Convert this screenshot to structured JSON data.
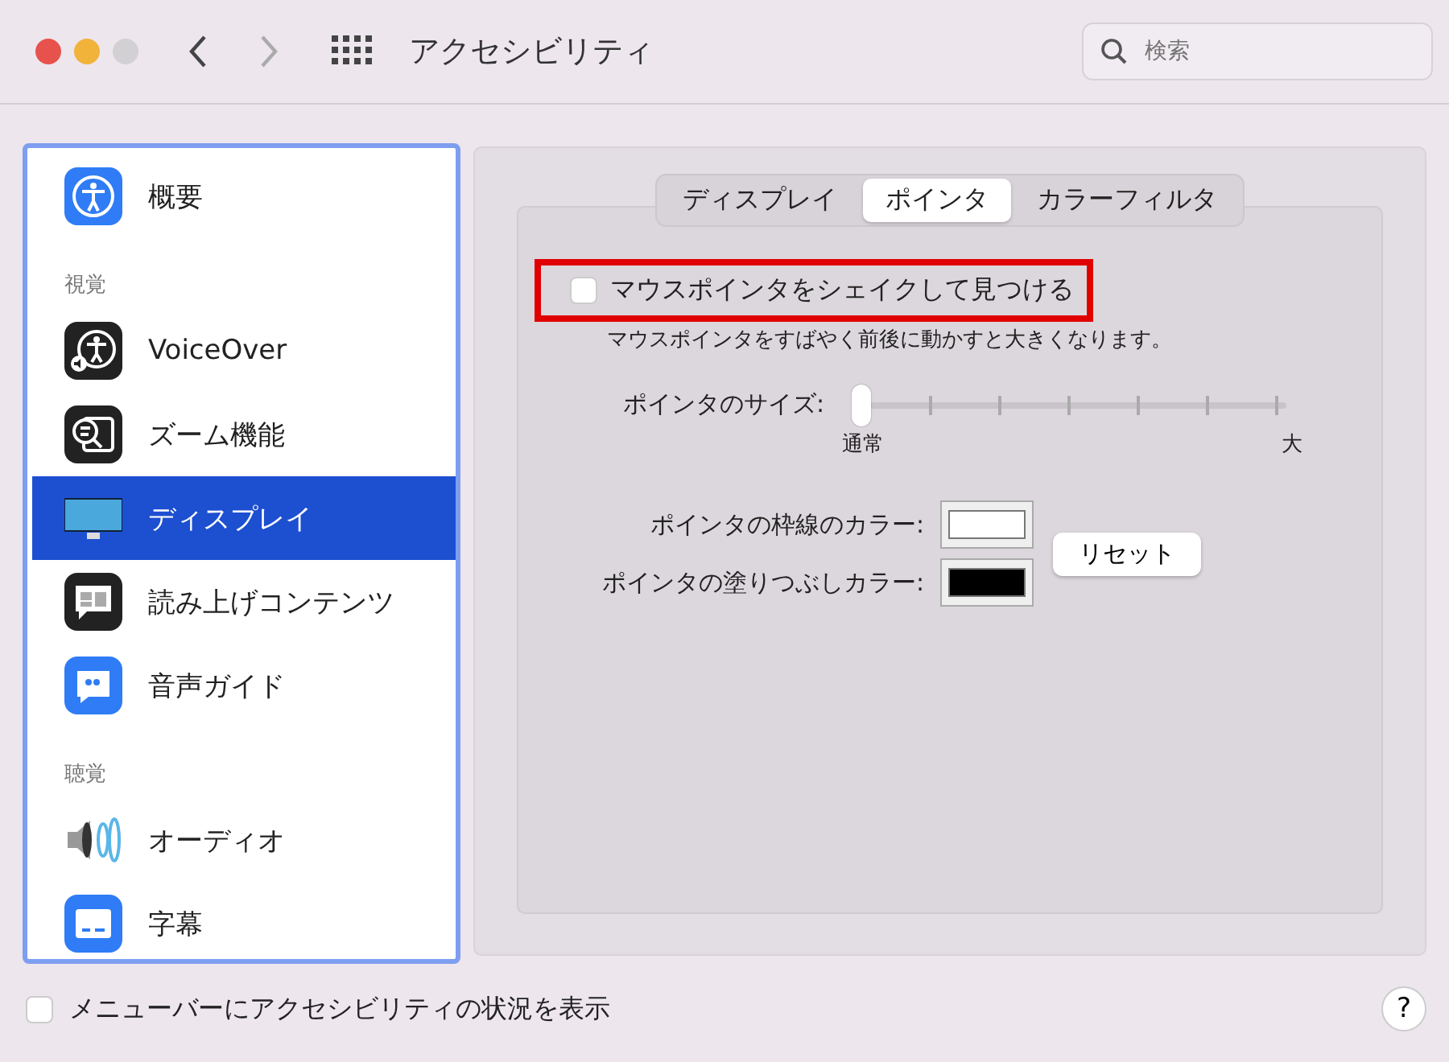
{
  "window": {
    "title": "アクセシビリティ"
  },
  "search": {
    "placeholder": "検索"
  },
  "sidebar": {
    "items": [
      {
        "kind": "item",
        "label": "概要",
        "selected": false
      },
      {
        "kind": "header",
        "label": "視覚"
      },
      {
        "kind": "item",
        "label": "VoiceOver",
        "selected": false
      },
      {
        "kind": "item",
        "label": "ズーム機能",
        "selected": false
      },
      {
        "kind": "item",
        "label": "ディスプレイ",
        "selected": true
      },
      {
        "kind": "item",
        "label": "読み上げコンテンツ",
        "selected": false
      },
      {
        "kind": "item",
        "label": "音声ガイド",
        "selected": false
      },
      {
        "kind": "header",
        "label": "聴覚"
      },
      {
        "kind": "item",
        "label": "オーディオ",
        "selected": false
      },
      {
        "kind": "item",
        "label": "字幕",
        "selected": false
      }
    ]
  },
  "tabs": [
    {
      "label": "ディスプレイ",
      "selected": false
    },
    {
      "label": "ポインタ",
      "selected": true
    },
    {
      "label": "カラーフィルタ",
      "selected": false
    }
  ],
  "shake_option": {
    "label": "マウスポインタをシェイクして見つける",
    "checked": false,
    "highlighted": true,
    "description": "マウスポインタをすばやく前後に動かすと大きくなります。"
  },
  "pointer_size": {
    "label": "ポインタのサイズ:",
    "level": 0,
    "min_label": "通常",
    "max_label": "大"
  },
  "colors": [
    {
      "label": "ポインタの枠線のカラー:",
      "color": "#ffffff"
    },
    {
      "label": "ポインタの塗りつぶしカラー:",
      "color": "#000000"
    }
  ],
  "reset_button": "リセット",
  "menubar_option": {
    "label": "メニューバーにアクセシビリティの状況を表示",
    "checked": false
  },
  "help_button": "?"
}
